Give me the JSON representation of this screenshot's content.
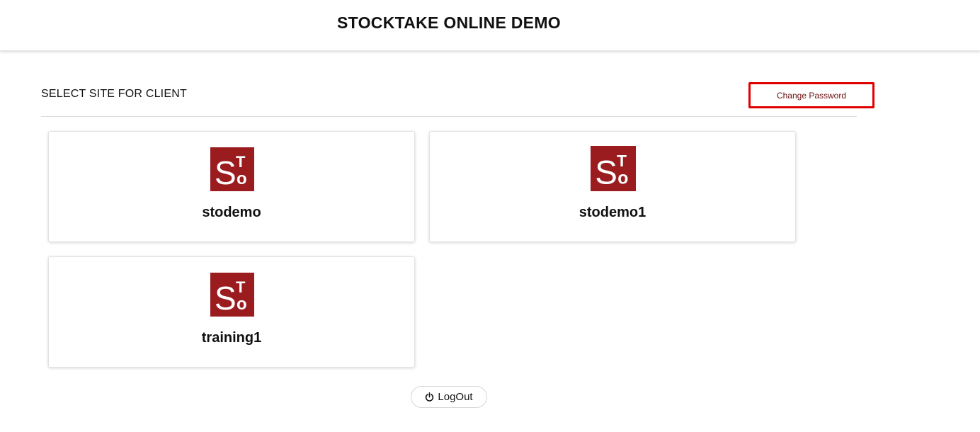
{
  "header": {
    "title": "STOCKTAKE ONLINE DEMO"
  },
  "page": {
    "section_title": "SELECT SITE FOR CLIENT",
    "change_password_label": "Change Password"
  },
  "logo": {
    "letter_s": "S",
    "letter_t": "T",
    "letter_o": "o",
    "color": "#9b1c1f"
  },
  "sites": [
    {
      "name": "stodemo"
    },
    {
      "name": "stodemo1"
    },
    {
      "name": "training1"
    }
  ],
  "footer": {
    "logout_label": "LogOut",
    "logout_icon": "power-icon"
  },
  "colors": {
    "highlight_border": "#e00000",
    "logo_bg": "#9b1c1f"
  }
}
